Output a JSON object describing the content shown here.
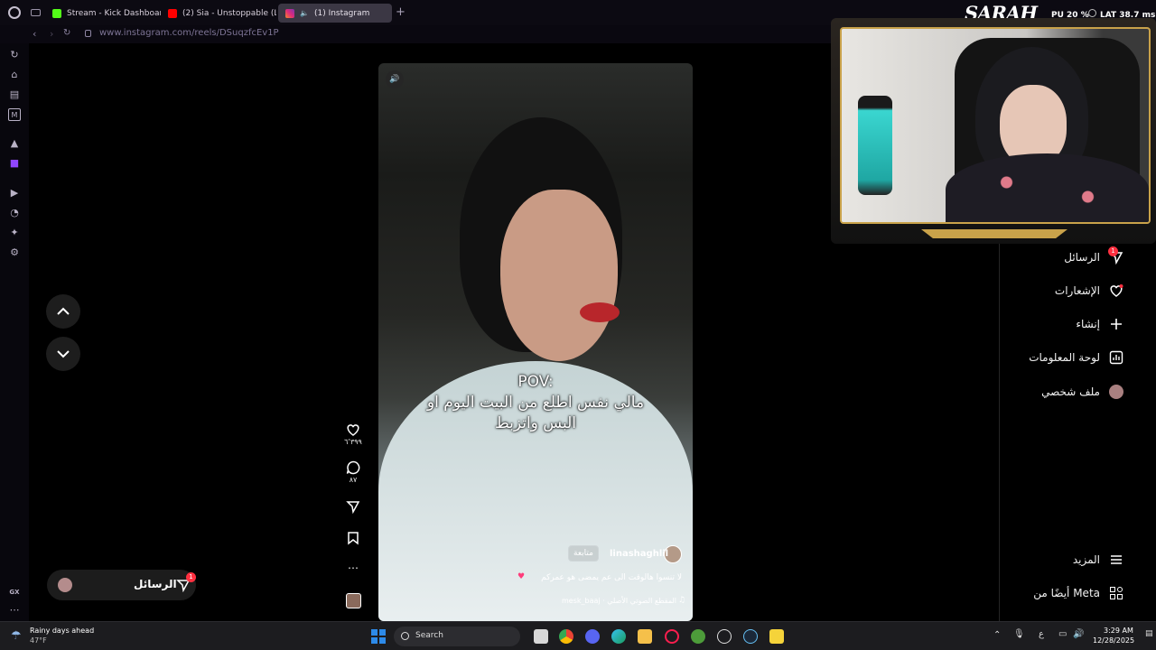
{
  "tabs": [
    {
      "label": "Stream - Kick Dashboard",
      "favicon_color": "#53fc18"
    },
    {
      "label": "(2) Sia - Unstoppable (Ly",
      "favicon_color": "#ff0000"
    },
    {
      "label": "(1) Instagram",
      "favicon_color": "#e1306c"
    }
  ],
  "address": {
    "url": "www.instagram.com/reels/DSuqzfcEv1P"
  },
  "stream_overlay": {
    "brand": "SARAH",
    "stats": "PU 20 %",
    "lat": "LAT 38.7 ms"
  },
  "reel": {
    "overlay_line1": "POV:",
    "overlay_line2": "مالي نفس اطلع من البيت اليوم او",
    "overlay_line3": "البس واتزبط",
    "username": "linashaghlil",
    "follow_label": "متابعة",
    "caption": "لا تنسوا هالوقت الى عم يمضى هو عمركم",
    "audio": "mesk_baaj · المقطع الصوتي الأصلي"
  },
  "actions": {
    "likes": "٦٬٣٩٩",
    "comments": "٨٧"
  },
  "right_nav": [
    {
      "label": "الرسائل",
      "icon": "messages-icon",
      "badge": "1"
    },
    {
      "label": "الإشعارات",
      "icon": "heart-icon"
    },
    {
      "label": "إنشاء",
      "icon": "plus-icon"
    },
    {
      "label": "لوحة المعلومات",
      "icon": "dashboard-icon"
    },
    {
      "label": "ملف شخصي",
      "icon": "profile-avatar"
    }
  ],
  "right_bottom": [
    {
      "label": "المزيد",
      "icon": "menu-icon"
    },
    {
      "label": "أيضًا من Meta",
      "icon": "meta-grid-icon"
    }
  ],
  "messages_pill": {
    "label": "الرسائل",
    "badge": "1"
  },
  "taskbar": {
    "weather_title": "Rainy days ahead",
    "weather_temp": "47°F",
    "search_label": "Search",
    "lang": "ع",
    "time": "3:29 AM",
    "date": "12/28/2025"
  },
  "colors": {
    "accent": "#c9a24a",
    "notify": "#ff3040"
  }
}
